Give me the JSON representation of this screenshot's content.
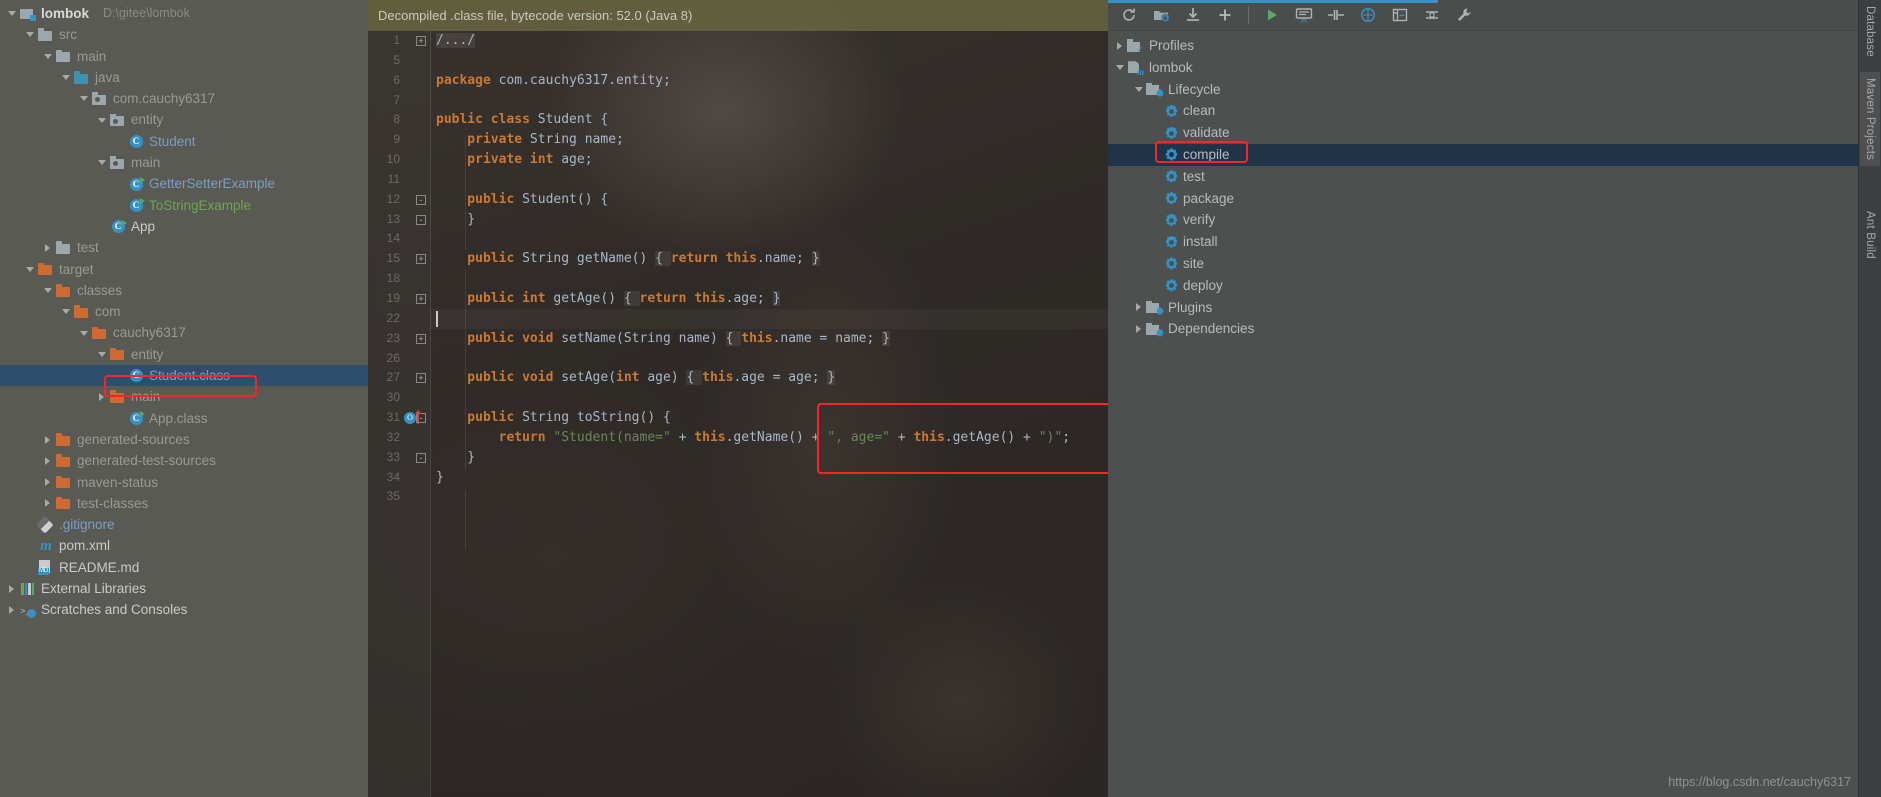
{
  "project": {
    "root": {
      "name": "lombok",
      "path": "D:\\gitee\\lombok"
    },
    "items": [
      {
        "label": "lombok",
        "sub": "D:\\gitee\\lombok",
        "depth": 0,
        "arrow": "down",
        "icon": "module-icon",
        "style": "bold"
      },
      {
        "label": "src",
        "sub": "",
        "depth": 1,
        "arrow": "down",
        "icon": "folder-icon",
        "style": "dim"
      },
      {
        "label": "main",
        "sub": "",
        "depth": 2,
        "arrow": "down",
        "icon": "folder-icon",
        "style": "dim"
      },
      {
        "label": "java",
        "sub": "",
        "depth": 3,
        "arrow": "down",
        "icon": "source-folder-icon",
        "style": "dim"
      },
      {
        "label": "com.cauchy6317",
        "sub": "",
        "depth": 4,
        "arrow": "down",
        "icon": "package-icon",
        "style": "dim"
      },
      {
        "label": "entity",
        "sub": "",
        "depth": 5,
        "arrow": "down",
        "icon": "package-icon",
        "style": "dim"
      },
      {
        "label": "Student",
        "sub": "",
        "depth": 6,
        "arrow": "none",
        "icon": "java-class-icon",
        "style": "blue"
      },
      {
        "label": "main",
        "sub": "",
        "depth": 5,
        "arrow": "down",
        "icon": "package-icon",
        "style": "dim"
      },
      {
        "label": "GetterSetterExample",
        "sub": "",
        "depth": 6,
        "arrow": "none",
        "icon": "java-class-runnable-icon",
        "style": "blue"
      },
      {
        "label": "ToStringExample",
        "sub": "",
        "depth": 6,
        "arrow": "none",
        "icon": "java-class-runnable-icon",
        "style": "green"
      },
      {
        "label": "App",
        "sub": "",
        "depth": 5,
        "arrow": "none",
        "icon": "java-class-runnable-icon",
        "style": "white"
      },
      {
        "label": "test",
        "sub": "",
        "depth": 2,
        "arrow": "right",
        "icon": "folder-icon",
        "style": "dim"
      },
      {
        "label": "target",
        "sub": "",
        "depth": 1,
        "arrow": "down",
        "icon": "folder-orange-icon",
        "style": "dim"
      },
      {
        "label": "classes",
        "sub": "",
        "depth": 2,
        "arrow": "down",
        "icon": "folder-orange-icon",
        "style": "dim"
      },
      {
        "label": "com",
        "sub": "",
        "depth": 3,
        "arrow": "down",
        "icon": "folder-orange-icon",
        "style": "dim"
      },
      {
        "label": "cauchy6317",
        "sub": "",
        "depth": 4,
        "arrow": "down",
        "icon": "folder-orange-icon",
        "style": "dim"
      },
      {
        "label": "entity",
        "sub": "",
        "depth": 5,
        "arrow": "down",
        "icon": "folder-orange-icon",
        "style": "dim"
      },
      {
        "label": "Student.class",
        "sub": "",
        "depth": 6,
        "arrow": "none",
        "icon": "class-file-icon",
        "style": "blue",
        "selected": true,
        "highlighted": true
      },
      {
        "label": "main",
        "sub": "",
        "depth": 5,
        "arrow": "right",
        "icon": "folder-orange-icon",
        "style": "dim"
      },
      {
        "label": "App.class",
        "sub": "",
        "depth": 6,
        "arrow": "none",
        "icon": "java-class-runnable-icon",
        "style": "dim"
      },
      {
        "label": "generated-sources",
        "sub": "",
        "depth": 2,
        "arrow": "right",
        "icon": "folder-orange-icon",
        "style": "dim"
      },
      {
        "label": "generated-test-sources",
        "sub": "",
        "depth": 2,
        "arrow": "right",
        "icon": "folder-orange-icon",
        "style": "dim"
      },
      {
        "label": "maven-status",
        "sub": "",
        "depth": 2,
        "arrow": "right",
        "icon": "folder-orange-icon",
        "style": "dim"
      },
      {
        "label": "test-classes",
        "sub": "",
        "depth": 2,
        "arrow": "right",
        "icon": "folder-orange-icon",
        "style": "dim"
      },
      {
        "label": ".gitignore",
        "sub": "",
        "depth": 1,
        "arrow": "none",
        "icon": "git-icon",
        "style": "blue"
      },
      {
        "label": "pom.xml",
        "sub": "",
        "depth": 1,
        "arrow": "none",
        "icon": "maven-pom-icon",
        "style": "white"
      },
      {
        "label": "README.md",
        "sub": "",
        "depth": 1,
        "arrow": "none",
        "icon": "markdown-icon",
        "style": "white"
      },
      {
        "label": "External Libraries",
        "sub": "",
        "depth": 0,
        "arrow": "right",
        "icon": "libraries-icon",
        "style": "white"
      },
      {
        "label": "Scratches and Consoles",
        "sub": "",
        "depth": 0,
        "arrow": "right",
        "icon": "scratches-icon",
        "style": "white"
      }
    ]
  },
  "editor": {
    "notice": "Decompiled .class file, bytecode version: 52.0 (Java 8)",
    "lines": [
      {
        "num": "1",
        "fold": "+",
        "tokens": [
          {
            "t": "/.../",
            "c": "fold-chip"
          }
        ]
      },
      {
        "num": "5",
        "fold": "",
        "tokens": []
      },
      {
        "num": "6",
        "fold": "",
        "tokens": [
          {
            "t": "package ",
            "c": "kw"
          },
          {
            "t": "com.cauchy6317.entity;",
            "c": "id"
          }
        ]
      },
      {
        "num": "7",
        "fold": "",
        "tokens": []
      },
      {
        "num": "8",
        "fold": "",
        "tokens": [
          {
            "t": "public class ",
            "c": "kw"
          },
          {
            "t": "Student {",
            "c": "id"
          }
        ]
      },
      {
        "num": "9",
        "fold": "",
        "tokens": [
          {
            "t": "    private ",
            "c": "kw"
          },
          {
            "t": "String name;",
            "c": "id"
          }
        ]
      },
      {
        "num": "10",
        "fold": "",
        "tokens": [
          {
            "t": "    private int ",
            "c": "kw"
          },
          {
            "t": "age;",
            "c": "id"
          }
        ]
      },
      {
        "num": "11",
        "fold": "",
        "tokens": []
      },
      {
        "num": "12",
        "fold": "-",
        "tokens": [
          {
            "t": "    public ",
            "c": "kw"
          },
          {
            "t": "Student() {",
            "c": "id"
          }
        ]
      },
      {
        "num": "13",
        "fold": "-",
        "tokens": [
          {
            "t": "    }",
            "c": "id"
          }
        ]
      },
      {
        "num": "14",
        "fold": "",
        "tokens": []
      },
      {
        "num": "15",
        "fold": "+",
        "tokens": [
          {
            "t": "    public ",
            "c": "kw"
          },
          {
            "t": "String getName() ",
            "c": "id"
          },
          {
            "t": "{ ",
            "c": "fold-chip"
          },
          {
            "t": "return ",
            "c": "kw"
          },
          {
            "t": "this",
            "c": "kw"
          },
          {
            "t": ".name; ",
            "c": "id"
          },
          {
            "t": "}",
            "c": "fold-chip"
          }
        ]
      },
      {
        "num": "18",
        "fold": "",
        "tokens": []
      },
      {
        "num": "19",
        "fold": "+",
        "tokens": [
          {
            "t": "    public int ",
            "c": "kw"
          },
          {
            "t": "getAge() ",
            "c": "id"
          },
          {
            "t": "{ ",
            "c": "fold-chip"
          },
          {
            "t": "return ",
            "c": "kw"
          },
          {
            "t": "this",
            "c": "kw"
          },
          {
            "t": ".age; ",
            "c": "id"
          },
          {
            "t": "}",
            "c": "fold-chip"
          }
        ]
      },
      {
        "num": "22",
        "fold": "",
        "tokens": [],
        "caret": true
      },
      {
        "num": "23",
        "fold": "+",
        "tokens": [
          {
            "t": "    public void ",
            "c": "kw"
          },
          {
            "t": "setName(String name) ",
            "c": "id"
          },
          {
            "t": "{ ",
            "c": "fold-chip"
          },
          {
            "t": "this",
            "c": "kw"
          },
          {
            "t": ".name = name; ",
            "c": "id"
          },
          {
            "t": "}",
            "c": "fold-chip"
          }
        ]
      },
      {
        "num": "26",
        "fold": "",
        "tokens": []
      },
      {
        "num": "27",
        "fold": "+",
        "tokens": [
          {
            "t": "    public void ",
            "c": "kw"
          },
          {
            "t": "setAge(",
            "c": "id"
          },
          {
            "t": "int ",
            "c": "kw"
          },
          {
            "t": "age) ",
            "c": "id"
          },
          {
            "t": "{ ",
            "c": "fold-chip"
          },
          {
            "t": "this",
            "c": "kw"
          },
          {
            "t": ".age = age; ",
            "c": "id"
          },
          {
            "t": "}",
            "c": "fold-chip"
          }
        ]
      },
      {
        "num": "30",
        "fold": "",
        "tokens": []
      },
      {
        "num": "31",
        "fold": "-",
        "tokens": [
          {
            "t": "    public ",
            "c": "kw"
          },
          {
            "t": "String toString() {",
            "c": "id"
          }
        ],
        "override": true
      },
      {
        "num": "32",
        "fold": "",
        "tokens": [
          {
            "t": "        return ",
            "c": "kw"
          },
          {
            "t": "\"Student(name=\"",
            "c": "str"
          },
          {
            "t": " + ",
            "c": "id"
          },
          {
            "t": "this",
            "c": "kw"
          },
          {
            "t": ".getName() + ",
            "c": "id"
          },
          {
            "t": "\", age=\"",
            "c": "str"
          },
          {
            "t": " + ",
            "c": "id"
          },
          {
            "t": "this",
            "c": "kw"
          },
          {
            "t": ".getAge() + ",
            "c": "id"
          },
          {
            "t": "\")\"",
            "c": "str"
          },
          {
            "t": ";",
            "c": "id"
          }
        ]
      },
      {
        "num": "33",
        "fold": "-",
        "tokens": [
          {
            "t": "    }",
            "c": "id"
          }
        ]
      },
      {
        "num": "34",
        "fold": "",
        "tokens": [
          {
            "t": "}",
            "c": "id"
          }
        ]
      },
      {
        "num": "35",
        "fold": "",
        "tokens": []
      }
    ]
  },
  "maven": {
    "toolbar": [
      {
        "name": "reimport-icon",
        "glyph": "refresh"
      },
      {
        "name": "generate-sources-icon",
        "glyph": "folder-sync"
      },
      {
        "name": "download-sources-icon",
        "glyph": "download"
      },
      {
        "name": "add-maven-project-icon",
        "glyph": "plus"
      },
      {
        "name": "run-maven-build-icon",
        "glyph": "play"
      },
      {
        "name": "execute-maven-goal-icon",
        "glyph": "console-m"
      },
      {
        "name": "toggle-skip-tests-icon",
        "glyph": "skip-tests"
      },
      {
        "name": "toggle-offline-icon",
        "glyph": "offline"
      },
      {
        "name": "show-dependencies-icon",
        "glyph": "diagram"
      },
      {
        "name": "collapse-all-icon",
        "glyph": "collapse"
      },
      {
        "name": "maven-settings-icon",
        "glyph": "wrench"
      }
    ],
    "tree": [
      {
        "label": "Profiles",
        "depth": 0,
        "arrow": "right",
        "icon": "profiles-folder-icon"
      },
      {
        "label": "lombok",
        "depth": 0,
        "arrow": "down",
        "icon": "maven-module-icon"
      },
      {
        "label": "Lifecycle",
        "depth": 1,
        "arrow": "down",
        "icon": "lifecycle-folder-icon"
      },
      {
        "label": "clean",
        "depth": 2,
        "arrow": "none",
        "icon": "maven-goal-icon"
      },
      {
        "label": "validate",
        "depth": 2,
        "arrow": "none",
        "icon": "maven-goal-icon"
      },
      {
        "label": "compile",
        "depth": 2,
        "arrow": "none",
        "icon": "maven-goal-icon",
        "selected": true,
        "highlighted": true
      },
      {
        "label": "test",
        "depth": 2,
        "arrow": "none",
        "icon": "maven-goal-icon"
      },
      {
        "label": "package",
        "depth": 2,
        "arrow": "none",
        "icon": "maven-goal-icon"
      },
      {
        "label": "verify",
        "depth": 2,
        "arrow": "none",
        "icon": "maven-goal-icon"
      },
      {
        "label": "install",
        "depth": 2,
        "arrow": "none",
        "icon": "maven-goal-icon"
      },
      {
        "label": "site",
        "depth": 2,
        "arrow": "none",
        "icon": "maven-goal-icon"
      },
      {
        "label": "deploy",
        "depth": 2,
        "arrow": "none",
        "icon": "maven-goal-icon"
      },
      {
        "label": "Plugins",
        "depth": 1,
        "arrow": "right",
        "icon": "plugins-folder-icon"
      },
      {
        "label": "Dependencies",
        "depth": 1,
        "arrow": "right",
        "icon": "dependencies-folder-icon"
      }
    ]
  },
  "right_strip": {
    "tabs": [
      {
        "label": "Database",
        "active": false
      },
      {
        "label": "Maven Projects",
        "active": true
      },
      {
        "label": "Ant Build",
        "active": false
      }
    ]
  },
  "watermark": "https://blog.csdn.net/cauchy6317",
  "colors": {
    "accent_blue": "#3592c4",
    "selection_blue": "#2d4f6b",
    "maven_selection": "#1f3449",
    "highlight_red": "#fb2424",
    "keyword_orange": "#cc7832",
    "string_green": "#6a8759",
    "folder_orange": "#cf6a33",
    "notice_bar": "#6a6842"
  }
}
